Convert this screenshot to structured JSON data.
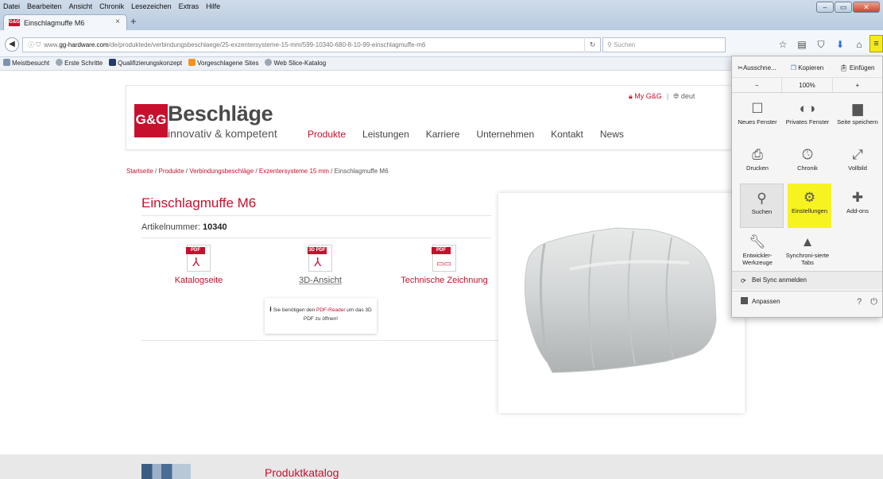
{
  "menubar": [
    "Datei",
    "Bearbeiten",
    "Ansicht",
    "Chronik",
    "Lesezeichen",
    "Extras",
    "Hilfe"
  ],
  "tab": {
    "title": "Einschlagmuffe M6",
    "favicon": "G&G"
  },
  "url": {
    "prefix": "www.",
    "domain": "gg-hardware.com",
    "path": "/de/produktede/verbindungsbeschlaege/25-exzentersysteme-15-mm/599-10340-680-8-10-99-einschlagmuffe-m6"
  },
  "search": {
    "placeholder": "Suchen"
  },
  "bookmarks": [
    "Meistbesucht",
    "Erste Schritte",
    "Qualifizierungskonzept",
    "Vorgeschlagene Sites",
    "Web Slice-Katalog"
  ],
  "site": {
    "logo_mark": "G&G",
    "logo_title": "Beschläge",
    "logo_tagline": "innovativ & kompetent",
    "nav": [
      "Produkte",
      "Leistungen",
      "Karriere",
      "Unternehmen",
      "Kontakt",
      "News"
    ],
    "my_account": "My G&G",
    "lang": "deut"
  },
  "breadcrumb": {
    "items": [
      "Startseite",
      "Produkte",
      "Verbindungsbeschläge",
      "Exzentersysteme 15 mm"
    ],
    "current": "Einschlagmuffe M6",
    "sep": "/"
  },
  "product": {
    "title": "Einschlagmuffe M6",
    "art_label": "Artikelnummer:",
    "art_number": "10340",
    "docs": [
      {
        "badge": "PDF",
        "label": "Katalogseite"
      },
      {
        "badge": "3D PDF",
        "label": "3D-Ansicht"
      },
      {
        "badge": "PDF",
        "label": "Technische Zeichnung"
      }
    ],
    "note_pre": "Sie benötigen den",
    "note_link": "PDF-Reader",
    "note_post": "um das 3D PDF zu öffnen!"
  },
  "footer": {
    "catalog": "Produktkatalog"
  },
  "panel": {
    "cut": "Ausschne...",
    "copy": "Kopieren",
    "paste": "Einfügen",
    "zoom_out": "−",
    "zoom": "100%",
    "zoom_in": "+",
    "items": [
      {
        "label": "Neues Fenster",
        "icon": "window-icon"
      },
      {
        "label": "Privates Fenster",
        "icon": "mask-icon"
      },
      {
        "label": "Seite speichern",
        "icon": "page-icon"
      },
      {
        "label": "Drucken",
        "icon": "printer-icon"
      },
      {
        "label": "Chronik",
        "icon": "clock-icon"
      },
      {
        "label": "Vollbild",
        "icon": "fullscreen-icon"
      },
      {
        "label": "Suchen",
        "icon": "search-icon"
      },
      {
        "label": "Einstellungen",
        "icon": "gear-icon"
      },
      {
        "label": "Add-ons",
        "icon": "puzzle-icon"
      },
      {
        "label": "Entwickler-Werkzeuge",
        "icon": "wrench-icon"
      },
      {
        "label": "Synchroni-sierte Tabs",
        "icon": "synced-tabs-icon"
      }
    ],
    "sync": "Bei Sync anmelden",
    "customize": "Anpassen"
  },
  "colors": {
    "brand": "#c8102e",
    "highlight": "#f7f321"
  }
}
